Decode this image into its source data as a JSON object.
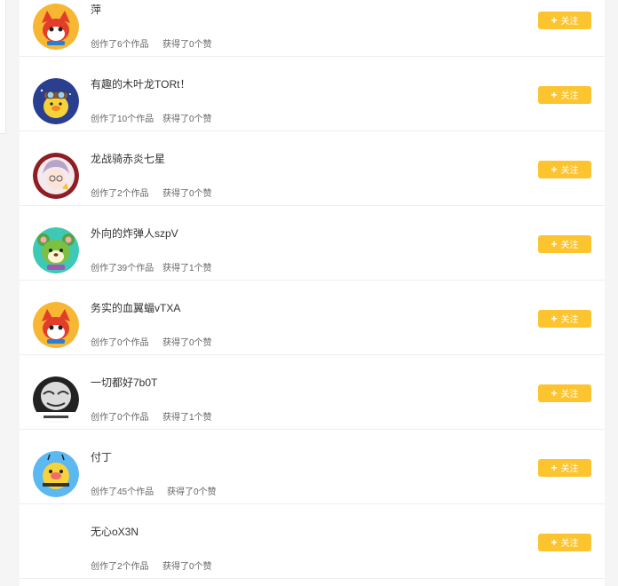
{
  "users": [
    {
      "name": "萍",
      "works": "创作了6个作品",
      "likes": "获得了0个赞",
      "avatar": "red-fox-cartoon-avatar",
      "avatar_color": "#f7b733"
    },
    {
      "name": "有趣的木叶龙TORt！",
      "works": "创作了10个作品",
      "likes": "获得了0个赞",
      "avatar": "yellow-duck-pilot-avatar",
      "avatar_color": "#2a3f8f"
    },
    {
      "name": "龙战骑赤炎七星",
      "works": "创作了2个作品",
      "likes": "获得了0个赞",
      "avatar": "anime-character-avatar",
      "avatar_color": "#8e1d24"
    },
    {
      "name": "外向的炸弹人szpV",
      "works": "创作了39个作品",
      "likes": "获得了1个赞",
      "avatar": "green-bear-cartoon-avatar",
      "avatar_color": "#3ec9b6"
    },
    {
      "name": "务实的血翼蝠vTXA",
      "works": "创作了0个作品",
      "likes": "获得了0个赞",
      "avatar": "red-fox-cartoon-avatar",
      "avatar_color": "#f7b733"
    },
    {
      "name": "一切都好7b0T",
      "works": "创作了0个作品",
      "likes": "获得了1个赞",
      "avatar": "meme-face-avatar",
      "avatar_color": "#333333"
    },
    {
      "name": "付丁",
      "works": "创作了45个作品",
      "likes": "获得了0个赞",
      "avatar": "yellow-bee-cartoon-avatar",
      "avatar_color": "#5bb8f0"
    },
    {
      "name": "无心oX3N",
      "works": "创作了2个作品",
      "likes": "获得了0个赞",
      "avatar": "",
      "avatar_color": "#ffffff"
    }
  ],
  "follow_label": "关注",
  "follow_icon": "plus-icon",
  "accent_color": "#fcc42f"
}
